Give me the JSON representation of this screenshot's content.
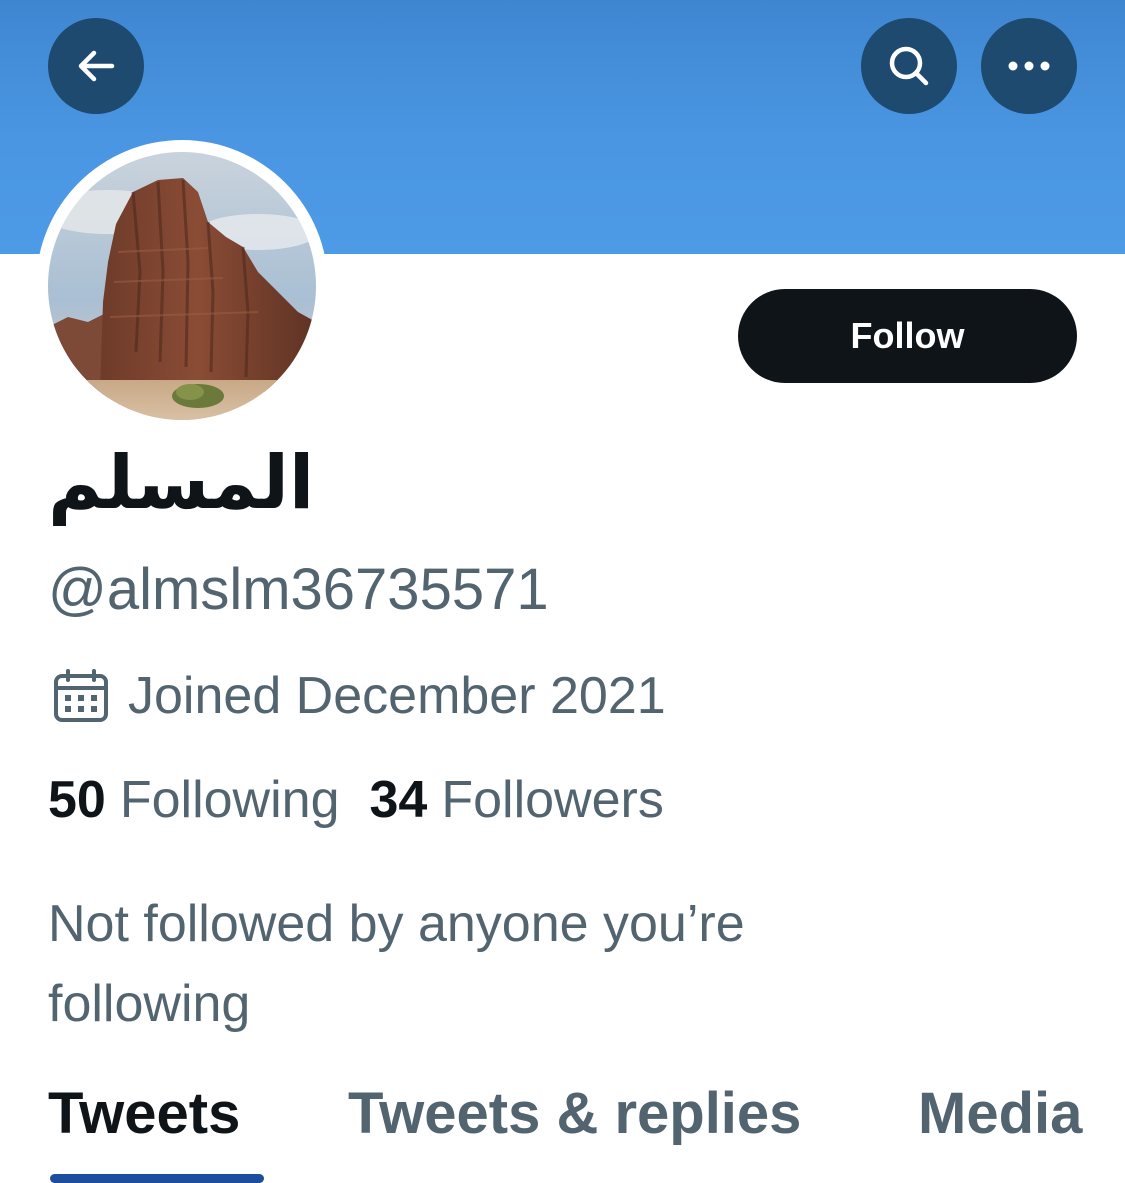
{
  "header": {
    "back_icon": "arrow-left-icon",
    "search_icon": "search-icon",
    "more_icon": "more-horizontal-icon",
    "banner_color": "#4a96e2",
    "button_color": "#1e4a70"
  },
  "profile": {
    "avatar": "desert rock formation photo",
    "follow_label": "Follow",
    "display_name": "المسلم",
    "handle": "@almslm36735571",
    "joined_icon": "calendar-icon",
    "joined_text": "Joined December 2021",
    "following_count": "50",
    "following_label": "Following",
    "followers_count": "34",
    "followers_label": "Followers",
    "not_followed_text": "Not followed by anyone you’re following"
  },
  "tabs": [
    {
      "label": "Tweets",
      "active": true
    },
    {
      "label": "Tweets & replies",
      "active": false
    },
    {
      "label": "Media",
      "active": false
    }
  ],
  "colors": {
    "primary_text": "#0f1419",
    "secondary_text": "#536471",
    "tab_indicator": "#1d4e9e"
  }
}
